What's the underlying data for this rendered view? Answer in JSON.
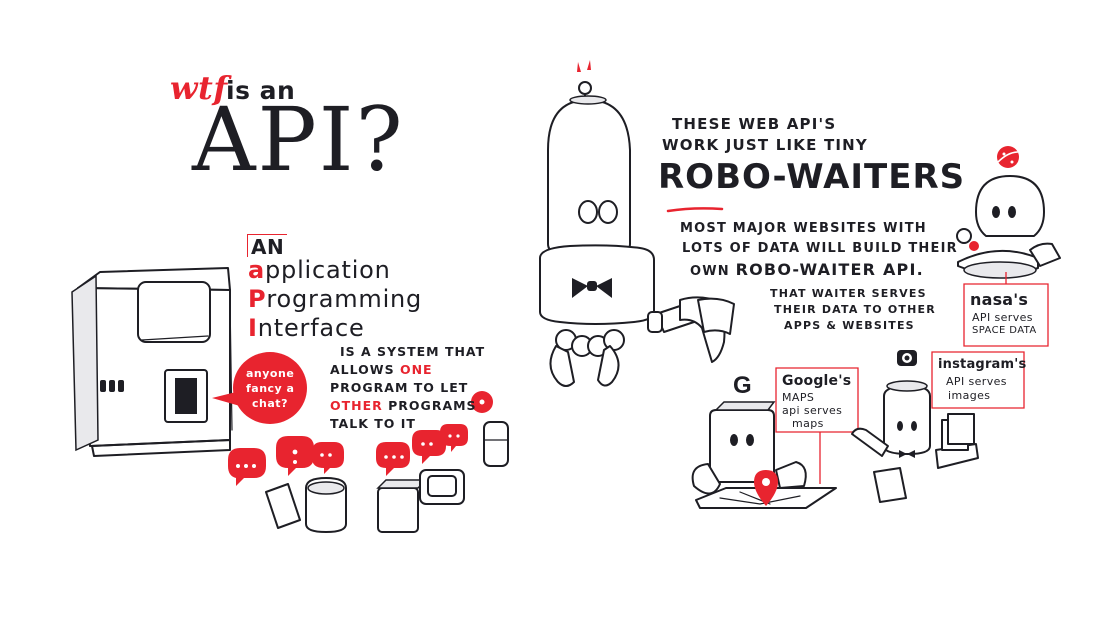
{
  "title": {
    "prefix": "wtf",
    "connector": "is an",
    "main": "API?"
  },
  "acronym": {
    "article": "AN",
    "words": [
      {
        "initial": "a",
        "rest": "pplication"
      },
      {
        "initial": "P",
        "rest": "rogramming"
      },
      {
        "initial": "I",
        "rest": "nterface"
      }
    ]
  },
  "definition": {
    "line1": "IS A SYSTEM THAT",
    "line2_pre": "ALLOWS",
    "line2_highlight": "ONE",
    "line3": "PROGRAM TO LET",
    "line4_highlight": "OTHER",
    "line4_post": "PROGRAMS",
    "line5": "TALK TO IT"
  },
  "speech_bubble": {
    "line1": "anyone",
    "line2": "fancy a",
    "line3": "chat?"
  },
  "intro": {
    "line1": "THESE WEB API'S",
    "line2": "WORK JUST LIKE TINY",
    "highlight": "ROBO-WAITERS"
  },
  "websites_text": {
    "line1": "MOST MAJOR WEBSITES WITH",
    "line2": "LOTS OF DATA WILL BUILD THEIR",
    "line3_pre": "OWN",
    "line3_highlight": "ROBO-WAITER API."
  },
  "waiter_text": {
    "line1": "THAT WAITER SERVES",
    "line2": "THEIR DATA TO OTHER",
    "line3": "APPS & WEBSITES"
  },
  "examples": [
    {
      "name": "nasa's",
      "line1": "API serves",
      "line2": "SPACE DATA"
    },
    {
      "name": "Google's",
      "line1": "MAPS",
      "line2": "api serves",
      "line3": "maps"
    },
    {
      "name": "instagram's",
      "line1": "API serves",
      "line2": "images"
    }
  ],
  "logos": {
    "google_letter": "G"
  },
  "colors": {
    "accent": "#e8242f",
    "ink": "#1e1e24",
    "paper": "#ffffff"
  }
}
